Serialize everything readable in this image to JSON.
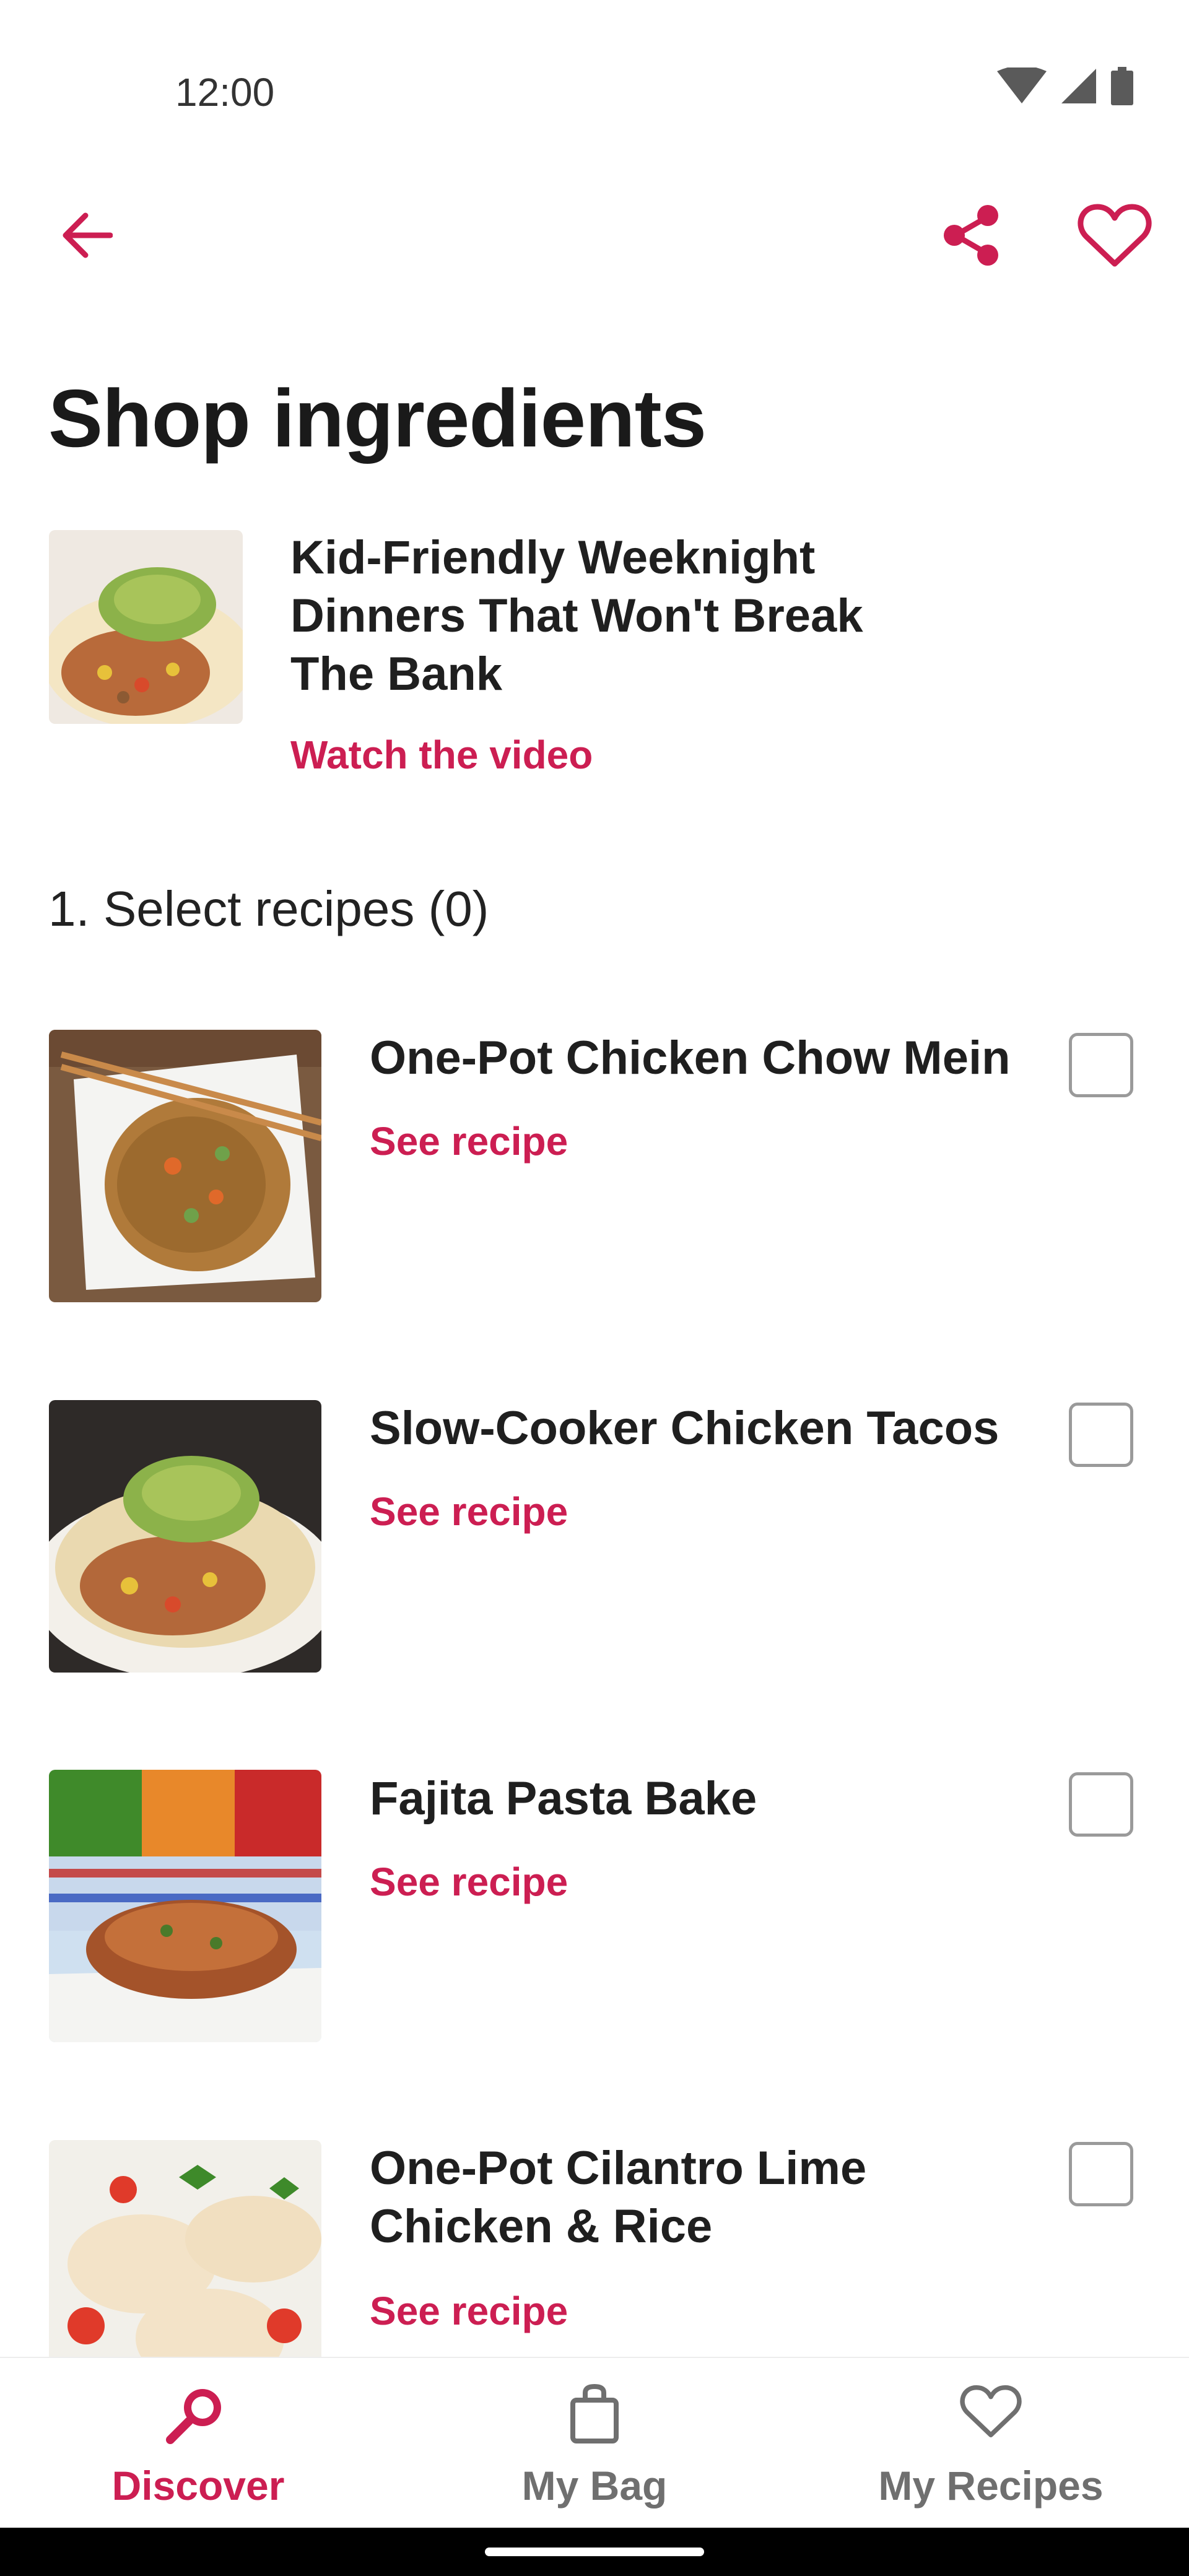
{
  "status": {
    "time": "12:00"
  },
  "header": {
    "title": "Shop ingredients",
    "back_icon": "arrow-left-icon",
    "share_icon": "share-icon",
    "favorite_icon": "heart-outline-icon"
  },
  "collection": {
    "title": "Kid-Friendly Weeknight Dinners That Won't Break The Bank",
    "link": "Watch the video"
  },
  "section": {
    "heading": "1. Select recipes (0)"
  },
  "recipes": [
    {
      "title": "One-Pot Chicken Chow Mein",
      "link": "See recipe",
      "checked": false
    },
    {
      "title": "Slow-Cooker Chicken Tacos",
      "link": "See recipe",
      "checked": false
    },
    {
      "title": "Fajita Pasta Bake",
      "link": "See recipe",
      "checked": false
    },
    {
      "title": "One-Pot Cilantro Lime Chicken & Rice",
      "link": "See recipe",
      "checked": false
    }
  ],
  "bottom_nav": {
    "items": [
      {
        "label": "Discover",
        "icon": "search-icon",
        "active": true
      },
      {
        "label": "My Bag",
        "icon": "bag-icon",
        "active": false
      },
      {
        "label": "My Recipes",
        "icon": "heart-outline-icon",
        "active": false
      }
    ]
  },
  "colors": {
    "accent": "#cc1e52",
    "inactive": "#6f6f6f",
    "text": "#1f1f1f"
  }
}
